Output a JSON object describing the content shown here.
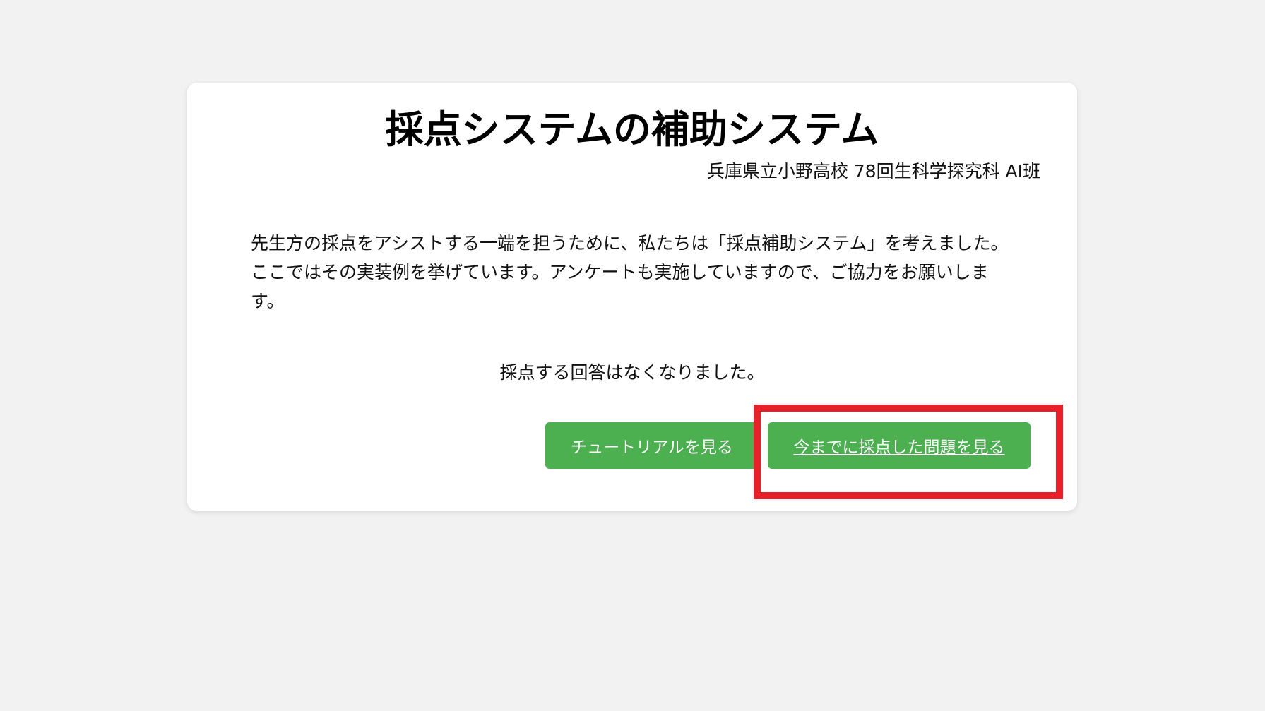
{
  "page": {
    "title": "採点システムの補助システム",
    "subtitle": "兵庫県立小野高校 78回生科学探究科 AI班",
    "description": "先生方の採点をアシストする一端を担うために、私たちは「採点補助システム」を考えました。ここではその実装例を挙げています。アンケートも実施していますので、ご協力をお願いします。",
    "status_message": "採点する回答はなくなりました。"
  },
  "actions": {
    "tutorial_label": "チュートリアルを見る",
    "history_label": "今までに採点した問題を見る"
  },
  "colors": {
    "background": "#f2f2f2",
    "card": "#ffffff",
    "button": "#4caf50",
    "highlight": "#e8202a"
  }
}
